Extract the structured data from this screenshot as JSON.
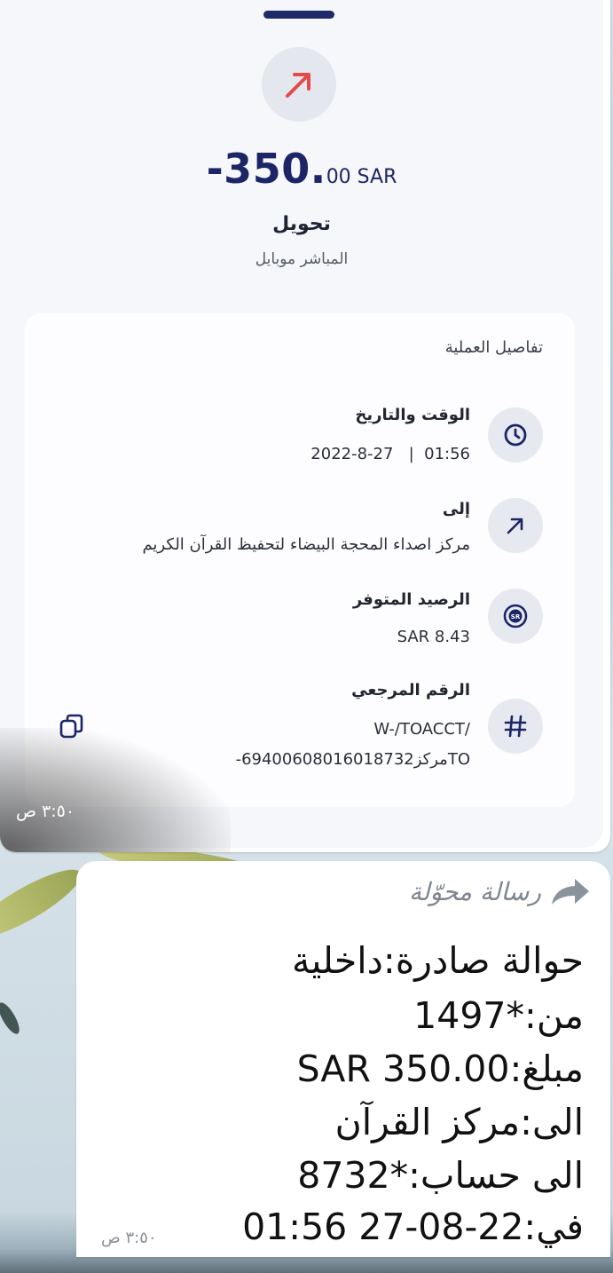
{
  "transaction_card": {
    "amount_main": "-350.",
    "amount_decimal": "00 SAR",
    "type": "تحويل",
    "channel": "المباشر موبايل",
    "details_title": "تفاصيل العملية",
    "rows": [
      {
        "icon": "clock-icon",
        "label": "الوقت والتاريخ",
        "value": "2022-8-27   |  01:56"
      },
      {
        "icon": "arrow-up-right-icon",
        "label": "إلى",
        "value": "مركز اصداء المحجة البيضاء لتحفيظ القرآن الكريم"
      },
      {
        "icon": "sar-coin-icon",
        "label": "الرصيد المتوفر",
        "value": "SAR 8.43"
      },
      {
        "icon": "hash-icon",
        "label": "الرقم المرجعي",
        "value": "W-/TOACCT/",
        "value2": "-مركز6940060801601873​2TO"
      }
    ],
    "accent_color": "#1c2566",
    "arrow_color": "#e34b4b",
    "timestamp": "٣:٥٠ ص"
  },
  "forwarded_message": {
    "forwarded_label": "رسالة محوّلة",
    "lines": [
      "حوالة صادرة:داخلية",
      "من:*1497",
      "مبلغ:SAR 350.00",
      "الى:مركز القرآن",
      "الى حساب:*8732",
      "في:22-08-27 01:56"
    ],
    "timestamp": "٣:٥٠ ص"
  }
}
